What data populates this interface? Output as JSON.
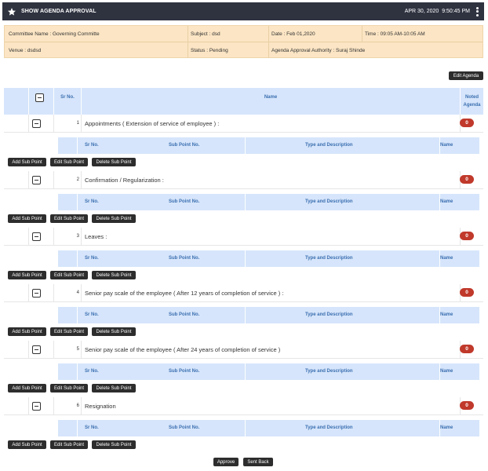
{
  "header": {
    "title": "SHOW AGENDA APPROVAL",
    "date": "APR 30, 2020",
    "time": "9:50:45 PM"
  },
  "info": {
    "committee": "Committee Name : Governing Committe",
    "subject": "Subject : dsd",
    "date": "Date : Feb 01,2020",
    "time": "Time : 09:05 AM-10:05 AM",
    "venue": "Venue : dsdsd",
    "status": "Status : Pending",
    "authority": "Agenda Approval Authority : Suraj Shinde"
  },
  "buttons": {
    "edit_agenda": "Edit Agenda",
    "add_sub": "Add Sub Point",
    "edit_sub": "Edit Sub Point",
    "delete_sub": "Delete Sub Point",
    "approve": "Approve",
    "sent_back": "Sent Back"
  },
  "table": {
    "col_sr": "Sr No.",
    "col_name": "Name",
    "col_noted_1": "Noted",
    "col_noted_2": "Agenda"
  },
  "sub_table": {
    "col_sr": "Sr No.",
    "col_sub": "Sub Point No.",
    "col_type": "Type and Description",
    "col_name": "Name"
  },
  "agendas": [
    {
      "sr": "1",
      "name": "Appointments ( Extension of service of employee ) :",
      "noted": "0"
    },
    {
      "sr": "2",
      "name": "Confirmation / Regularization :",
      "noted": "0"
    },
    {
      "sr": "3",
      "name": "Leaves :",
      "noted": "0"
    },
    {
      "sr": "4",
      "name": "Senior pay scale of the employee ( After 12 years of completion of service ) :",
      "noted": "0"
    },
    {
      "sr": "5",
      "name": "Senior pay scale of the employee ( After 24 years of completion of service )",
      "noted": "0"
    },
    {
      "sr": "6",
      "name": "Resignation",
      "noted": "0"
    }
  ]
}
